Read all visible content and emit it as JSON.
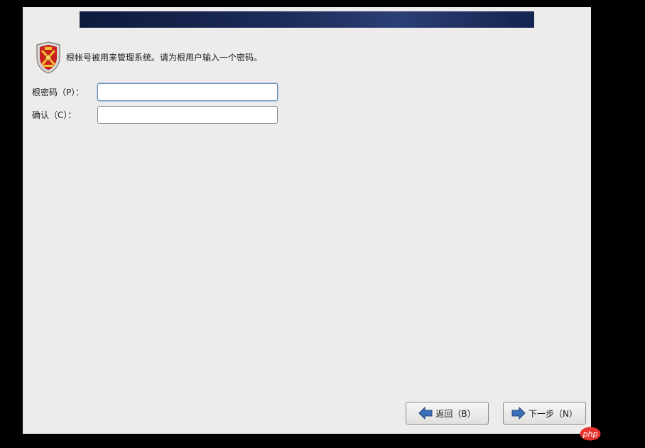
{
  "intro": {
    "text": "根帐号被用来管理系统。请为根用户输入一个密码。"
  },
  "form": {
    "root_password_label": "根密码（P）：",
    "confirm_label": "确认（C）：",
    "root_password_value": "",
    "confirm_value": ""
  },
  "buttons": {
    "back_label": "返回（B）",
    "next_label": "下一步（N）"
  },
  "icons": {
    "intro": "shield-icon",
    "back": "arrow-left-icon",
    "next": "arrow-right-icon"
  },
  "watermark": {
    "text": "php"
  },
  "colors": {
    "window_bg": "#edeceb",
    "banner": "#1c2c5a",
    "arrow_blue": "#3d6fb6",
    "shield_red": "#c8201e",
    "watermark_red": "#e8342f"
  }
}
